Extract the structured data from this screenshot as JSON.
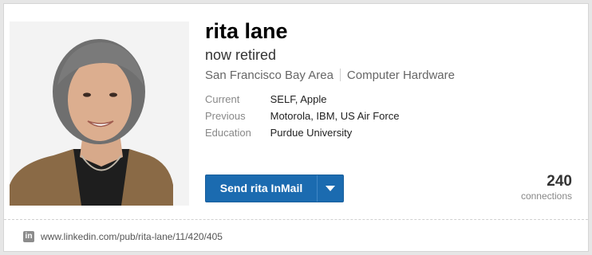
{
  "profile": {
    "name": "rita lane",
    "headline": "now retired",
    "location": "San Francisco Bay Area",
    "industry": "Computer Hardware"
  },
  "facts": [
    {
      "label": "Current",
      "value": "SELF, Apple"
    },
    {
      "label": "Previous",
      "value": "Motorola, IBM, US Air Force"
    },
    {
      "label": "Education",
      "value": "Purdue University"
    }
  ],
  "actions": {
    "inmail_label": "Send rita InMail"
  },
  "connections": {
    "count": "240",
    "label": "connections"
  },
  "footer": {
    "icon_text": "in",
    "url": "www.linkedin.com/pub/rita-lane/11/420/405"
  },
  "colors": {
    "button_blue": "#1b6bb0",
    "background": "#e6e6e6"
  }
}
